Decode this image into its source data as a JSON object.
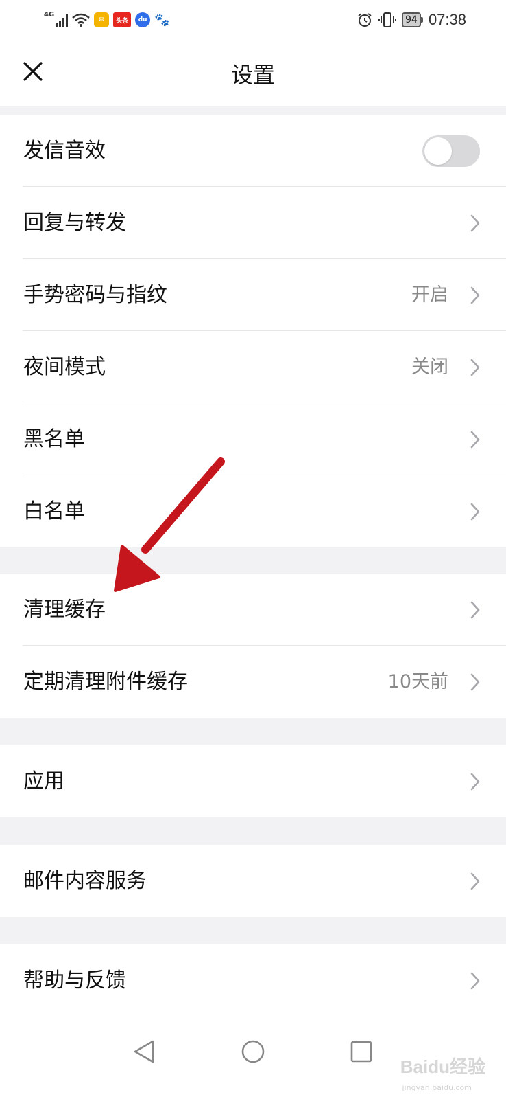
{
  "status_bar": {
    "signal_label": "4G",
    "app_badges": [
      {
        "icon": "mail-app-icon",
        "text": "✉"
      },
      {
        "icon": "toutiao-app-icon",
        "text": "头条"
      },
      {
        "icon": "baidu-app-icon",
        "text": "du"
      },
      {
        "icon": "baidu-paw-icon",
        "text": "🐾"
      }
    ],
    "battery": "94",
    "time": "07:38"
  },
  "header": {
    "title": "设置",
    "close_icon": "close-icon"
  },
  "sections": [
    {
      "items": [
        {
          "label": "发信音效",
          "type": "toggle",
          "toggle_on": false
        },
        {
          "label": "回复与转发",
          "type": "link",
          "value": ""
        },
        {
          "label": "手势密码与指纹",
          "type": "link",
          "value": "开启"
        },
        {
          "label": "夜间模式",
          "type": "link",
          "value": "关闭"
        },
        {
          "label": "黑名单",
          "type": "link",
          "value": ""
        },
        {
          "label": "白名单",
          "type": "link",
          "value": ""
        }
      ]
    },
    {
      "items": [
        {
          "label": "清理缓存",
          "type": "link",
          "value": ""
        },
        {
          "label": "定期清理附件缓存",
          "type": "link",
          "value": "10天前"
        }
      ]
    },
    {
      "items": [
        {
          "label": "应用",
          "type": "link",
          "value": ""
        }
      ]
    },
    {
      "items": [
        {
          "label": "邮件内容服务",
          "type": "link",
          "value": ""
        }
      ]
    },
    {
      "items": [
        {
          "label": "帮助与反馈",
          "type": "link",
          "value": ""
        }
      ]
    }
  ],
  "nav_bar": {
    "back_icon": "back-triangle-icon",
    "home_icon": "home-circle-icon",
    "recents_icon": "recents-square-icon"
  },
  "annotation": {
    "arrow_color": "#c4161c"
  },
  "watermark": {
    "text": "Baidu经验",
    "subtext": "jingyan.baidu.com"
  },
  "colors": {
    "background": "#f2f2f4",
    "toggle_off": "#d9d9dc",
    "secondary_text": "#888888"
  }
}
